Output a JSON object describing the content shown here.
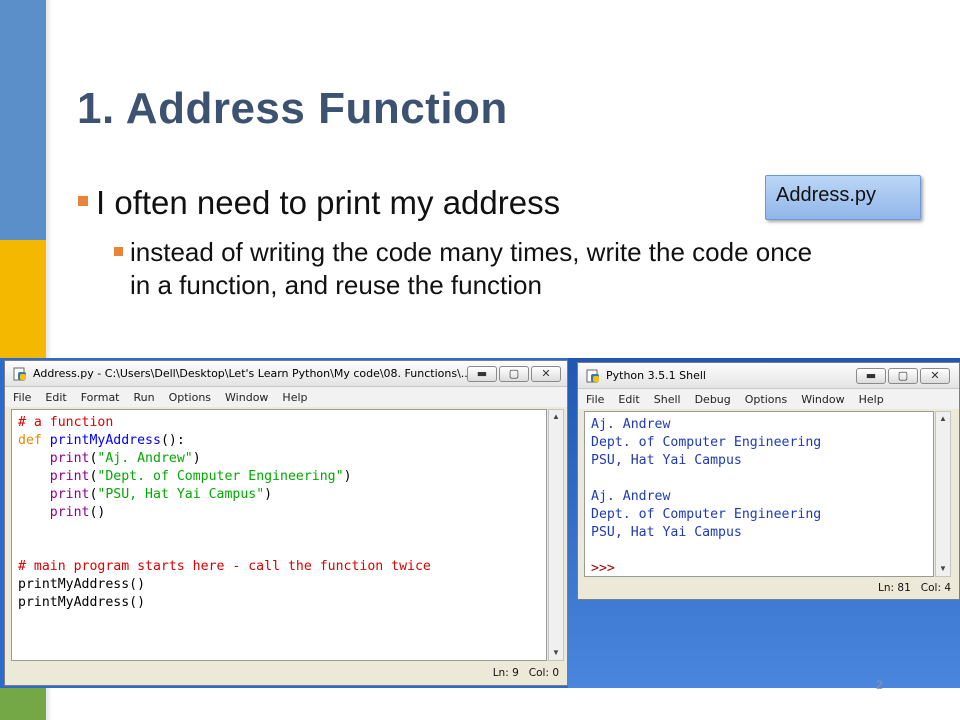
{
  "slide": {
    "title": "1.  Address Function",
    "bullet1": "I often need to print my address",
    "bullet2": "instead of writing the code many times, write the code once in a function, and reuse the function",
    "callout": "Address.py",
    "page_number": "2"
  },
  "colors": {
    "title": "#3c5270",
    "bullet_square": "#e8833a",
    "stripe_blue": "#5b8fc9",
    "stripe_yellow": "#f5b800",
    "stripe_green": "#74a846"
  },
  "editor_window": {
    "title": "Address.py - C:\\Users\\Dell\\Desktop\\Let's Learn Python\\My code\\08. Functions\\...",
    "menu": [
      "File",
      "Edit",
      "Format",
      "Run",
      "Options",
      "Window",
      "Help"
    ],
    "code": {
      "l1": "# a function",
      "l2_kw": "def",
      "l2_fn": "printMyAddress",
      "l2_rest": "():",
      "l3_bi": "print",
      "l3_a": "(",
      "l3_s": "\"Aj. Andrew\"",
      "l3_b": ")",
      "l4_bi": "print",
      "l4_a": "(",
      "l4_s": "\"Dept. of Computer Engineering\"",
      "l4_b": ")",
      "l5_bi": "print",
      "l5_a": "(",
      "l5_s": "\"PSU, Hat Yai Campus\"",
      "l5_b": ")",
      "l6_bi": "print",
      "l6_rest": "()",
      "l7": "# main program starts here - call the function twice",
      "l8": "printMyAddress()",
      "l9": "printMyAddress()"
    },
    "status_ln": "Ln: 9",
    "status_col": "Col: 0"
  },
  "shell_window": {
    "title": "Python 3.5.1 Shell",
    "menu": [
      "File",
      "Edit",
      "Shell",
      "Debug",
      "Options",
      "Window",
      "Help"
    ],
    "output": [
      "Aj. Andrew",
      "Dept. of Computer Engineering",
      "PSU, Hat Yai Campus",
      "",
      "Aj. Andrew",
      "Dept. of Computer Engineering",
      "PSU, Hat Yai Campus"
    ],
    "prompt": ">>>",
    "status_ln": "Ln: 81",
    "status_col": "Col: 4"
  },
  "icons": {
    "minimize": "minimize-icon",
    "maximize": "maximize-icon",
    "close": "close-icon",
    "python": "python-file-icon"
  }
}
